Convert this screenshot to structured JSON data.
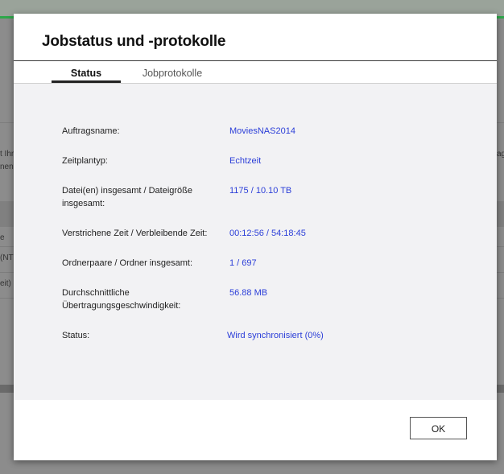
{
  "background": {
    "fragments": [
      "t Ihr",
      "nen",
      "ag",
      "e",
      "(NT",
      "eit)"
    ]
  },
  "dialog": {
    "title": "Jobstatus und -protokolle",
    "tabs": [
      {
        "label": "Status",
        "active": true
      },
      {
        "label": "Jobprotokolle",
        "active": false
      }
    ],
    "rows": [
      {
        "label": "Auftragsname:",
        "value": "MoviesNAS2014"
      },
      {
        "label": "Zeitplantyp:",
        "value": "Echtzeit"
      },
      {
        "label": "Datei(en) insgesamt / Dateigröße insgesamt:",
        "value": "1175 / 10.10 TB"
      },
      {
        "label": "Verstrichene Zeit / Verbleibende Zeit:",
        "value": "00:12:56 / 54:18:45"
      },
      {
        "label": "Ordnerpaare / Ordner insgesamt:",
        "value": "1 / 697"
      },
      {
        "label": "Durchschnittliche Übertragungsgeschwindigkeit:",
        "value": "56.88 MB"
      },
      {
        "label": "Status:",
        "value": "Wird synchronisiert (0%)"
      }
    ],
    "ok_label": "OK"
  },
  "colors": {
    "value_text": "#2b3ed8",
    "content_bg": "#f2f2f4",
    "accent_green": "#2ea84a"
  }
}
